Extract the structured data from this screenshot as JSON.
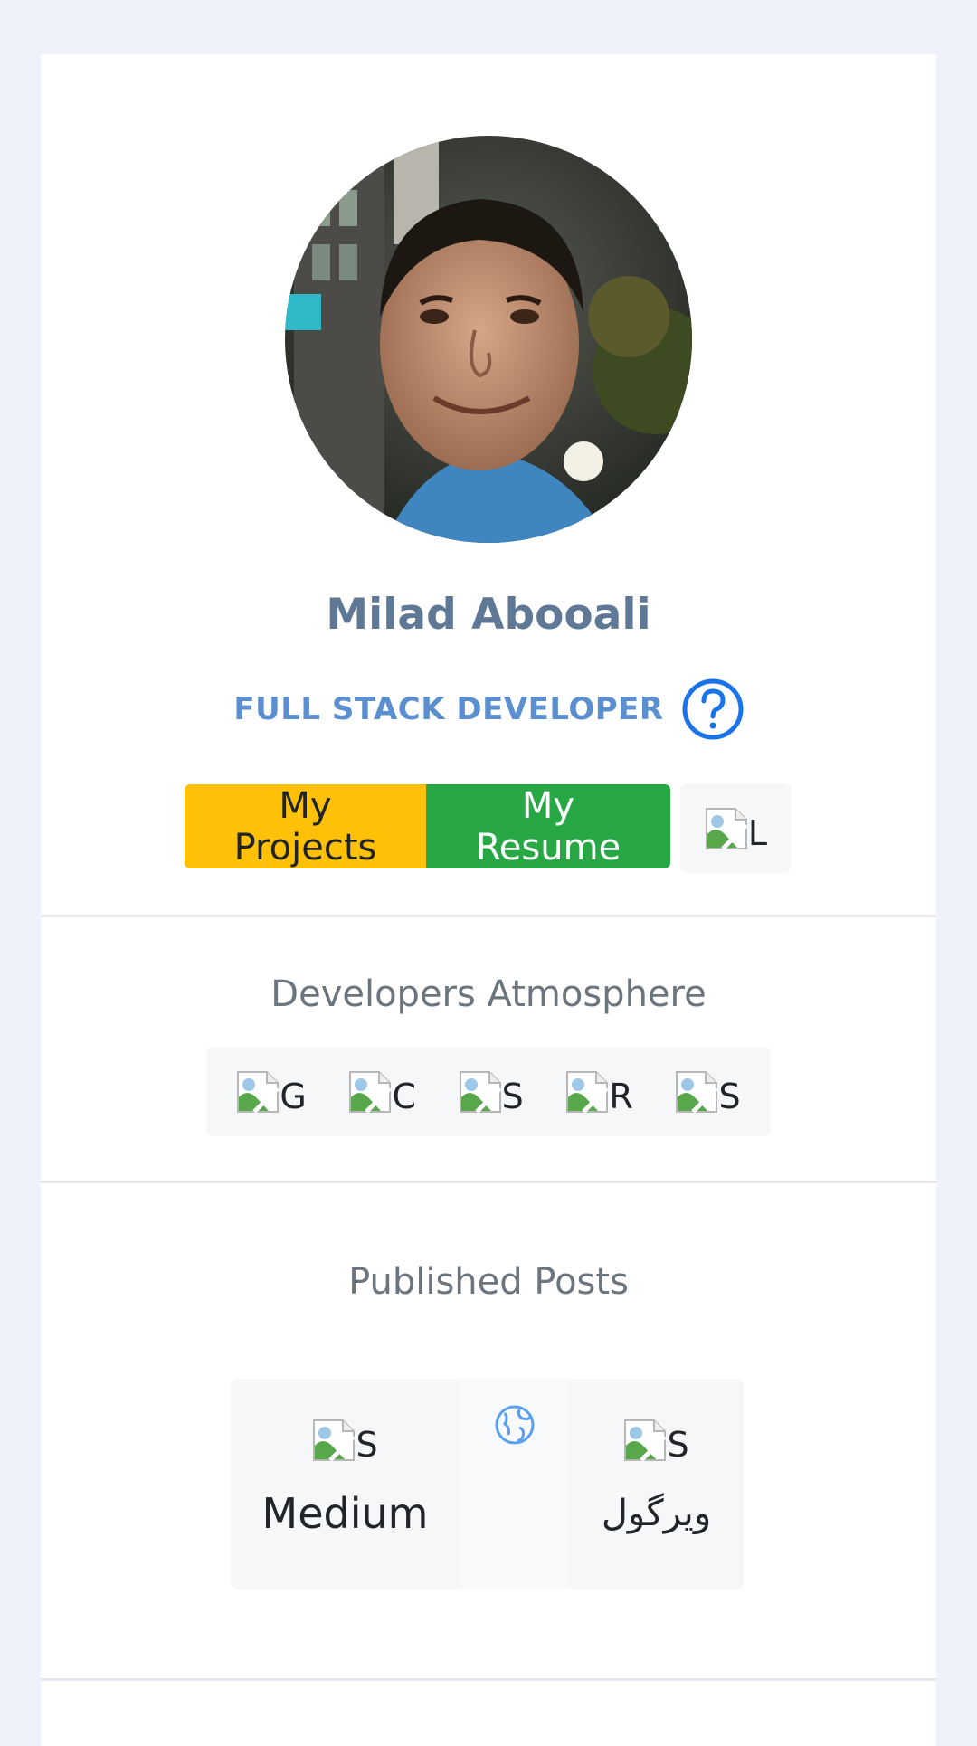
{
  "profile": {
    "name": "Milad Abooali",
    "role": "FULL STACK DEVELOPER",
    "avatar_icon": "profile-photo"
  },
  "buttons": {
    "projects_label": "My Projects",
    "resume_label": "My Resume"
  },
  "language_image": {
    "alt": "L",
    "icon": "broken-image-icon"
  },
  "atmosphere": {
    "title": "Developers Atmosphere",
    "items": [
      {
        "alt": "G"
      },
      {
        "alt": "C"
      },
      {
        "alt": "S"
      },
      {
        "alt": "R"
      },
      {
        "alt": "S"
      }
    ]
  },
  "posts": {
    "title": "Published Posts",
    "medium": {
      "alt": "S",
      "label": "Medium"
    },
    "virgool": {
      "alt": "S",
      "label": "ویرگول"
    },
    "globe_icon": "globe-icon"
  },
  "colors": {
    "background": "#eff2fa",
    "name": "#5f7895",
    "role": "#5b8fcf",
    "projects_button": "#ffc107",
    "resume_button": "#28a745",
    "help_icon": "#1a73e8",
    "globe_icon": "#5aa0f0"
  }
}
